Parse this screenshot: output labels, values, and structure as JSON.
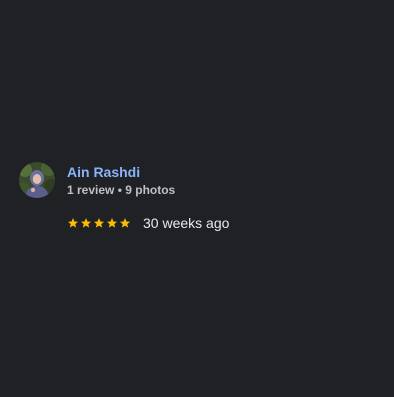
{
  "review": {
    "reviewer_name": "Ain Rashdi",
    "reviewer_stats": "1 review • 9 photos",
    "rating": 5,
    "rating_max": 5,
    "time_ago": "30 weeks ago"
  },
  "colors": {
    "background": "#202124",
    "name": "#8ab4f8",
    "star": "#fbbc04",
    "text": "#e8eaed"
  },
  "icons": {
    "star": "star-icon",
    "avatar": "profile-photo"
  }
}
